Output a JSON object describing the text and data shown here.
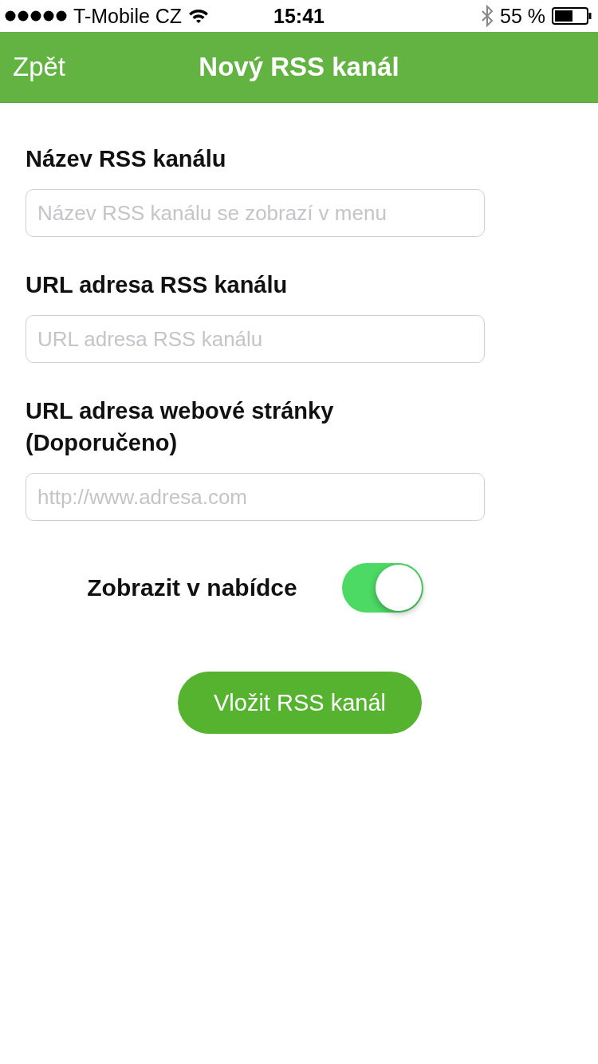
{
  "status_bar": {
    "carrier": "T-Mobile CZ",
    "time": "15:41",
    "battery": "55 %"
  },
  "nav": {
    "back": "Zpět",
    "title": "Nový RSS kanál"
  },
  "fields": [
    {
      "label": "Název RSS kanálu",
      "placeholder": "Název RSS kanálu se zobrazí v menu"
    },
    {
      "label": "URL adresa RSS kanálu",
      "placeholder": "URL adresa RSS kanálu"
    },
    {
      "label": "URL adresa webové stránky (Doporučeno)",
      "placeholder": "http://www.adresa.com"
    }
  ],
  "toggle": {
    "label": "Zobrazit v nabídce",
    "on": true
  },
  "submit": "Vložit RSS kanál"
}
